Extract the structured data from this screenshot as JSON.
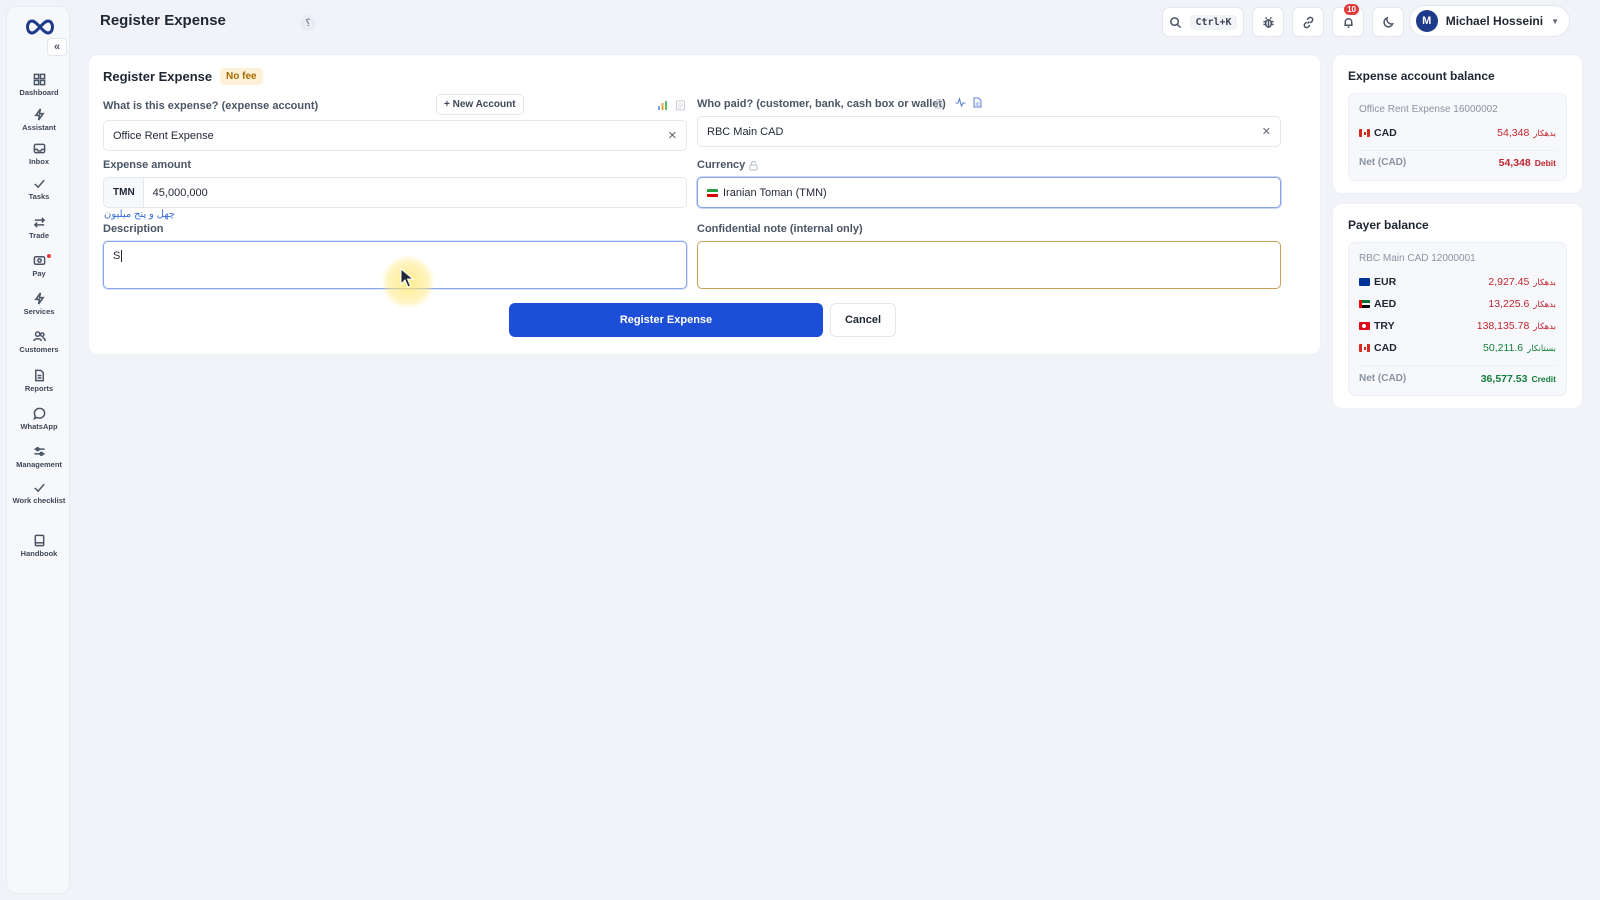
{
  "header": {
    "title": "Register Expense",
    "help_glyph": "؟",
    "search_shortcut": "Ctrl+K",
    "notification_count": "10",
    "user_initial": "M",
    "user_name": "Michael Hosseini"
  },
  "sidebar": {
    "collapse_glyph": "«",
    "items": [
      {
        "label": "Dashboard",
        "icon": "dashboard-icon"
      },
      {
        "label": "Assistant",
        "icon": "bolt-icon"
      },
      {
        "label": "Inbox",
        "icon": "inbox-icon"
      },
      {
        "label": "Tasks",
        "icon": "check-icon"
      },
      {
        "label": "Trade",
        "icon": "swap-icon"
      },
      {
        "label": "Pay",
        "icon": "wallet-icon"
      },
      {
        "label": "Services",
        "icon": "bolt-icon"
      },
      {
        "label": "Customers",
        "icon": "users-icon"
      },
      {
        "label": "Reports",
        "icon": "file-icon"
      },
      {
        "label": "WhatsApp",
        "icon": "chat-icon"
      },
      {
        "label": "Management",
        "icon": "sliders-icon"
      },
      {
        "label": "Work checklist",
        "icon": "check-icon"
      },
      {
        "label": "Handbook",
        "icon": "book-icon"
      }
    ]
  },
  "form": {
    "title": "Register Expense",
    "fee_badge": "No fee",
    "expense_account_label": "What is this expense? (expense account)",
    "new_account_label": "+ New Account",
    "expense_account_value": "Office Rent Expense",
    "payer_label": "Who paid? (customer, bank, cash box or wallet)",
    "payer_value": "RBC Main CAD",
    "amount_label": "Expense amount",
    "amount_prefix": "TMN",
    "amount_value": "45,000,000",
    "amount_words": "چهل و پنج میلیون",
    "currency_label": "Currency",
    "currency_value": "Iranian Toman (TMN)",
    "description_label": "Description",
    "description_value": "S",
    "note_label": "Confidential note (internal only)",
    "note_value": "",
    "submit_label": "Register Expense",
    "cancel_label": "Cancel"
  },
  "expense_balance": {
    "title": "Expense account balance",
    "account": "Office Rent Expense 16000002",
    "rows": [
      {
        "currency": "CAD",
        "amount": "54,348",
        "tag": "بدهکار"
      }
    ],
    "net_label": "Net (CAD)",
    "net_value": "54,348",
    "net_tag": "Debit"
  },
  "payer_balance": {
    "title": "Payer balance",
    "account": "RBC Main CAD 12000001",
    "rows": [
      {
        "currency": "EUR",
        "amount": "2,927.45",
        "tag": "بدهکار"
      },
      {
        "currency": "AED",
        "amount": "13,225.6",
        "tag": "بدهکار"
      },
      {
        "currency": "TRY",
        "amount": "138,135.78",
        "tag": "بدهکار"
      },
      {
        "currency": "CAD",
        "amount": "50,211.6",
        "tag": "بستانکار"
      }
    ],
    "net_label": "Net (CAD)",
    "net_value": "36,577.53",
    "net_tag": "Credit"
  },
  "colors": {
    "primary": "#1d4ed8",
    "debit": "#c0262d",
    "credit": "#15803d",
    "badge_bg": "#fdf2d8"
  }
}
